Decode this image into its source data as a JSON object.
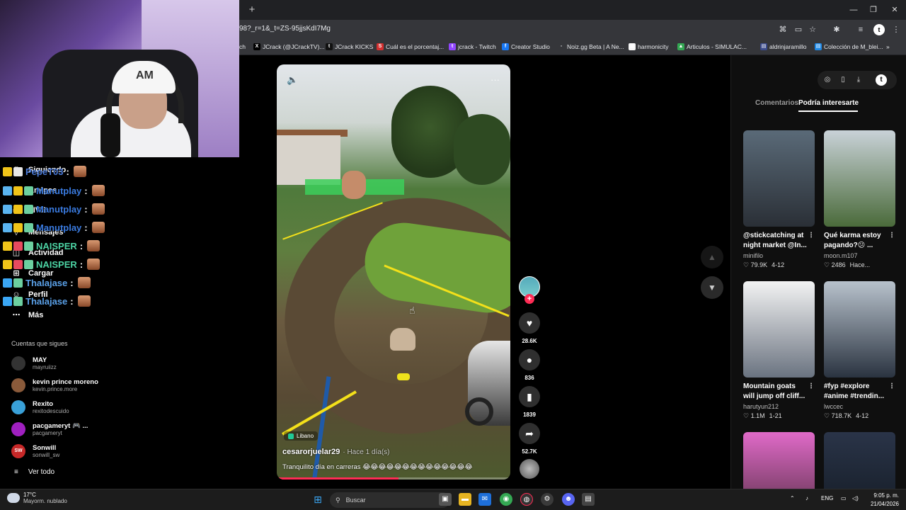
{
  "browser": {
    "url": "98?_r=1&_t=ZS-95jjsKdI7Mg",
    "bookmarks": [
      {
        "label": "ch",
        "icon_color": "#35363a",
        "glyph": ""
      },
      {
        "label": "JCrack (@JCrackTV)...",
        "icon_color": "#000000",
        "glyph": "X"
      },
      {
        "label": "JCrack KICKS",
        "icon_color": "#111111",
        "glyph": "t"
      },
      {
        "label": "Cuál es el porcentaj...",
        "icon_color": "#d32f2f",
        "glyph": "S"
      },
      {
        "label": "jcrack - Twitch",
        "icon_color": "#9146ff",
        "glyph": "t"
      },
      {
        "label": "Creator Studio",
        "icon_color": "#1877f2",
        "glyph": "f"
      },
      {
        "label": "Noiz.gg Beta | A Ne...",
        "icon_color": "#35363a",
        "glyph": "◦"
      },
      {
        "label": "harmonicity",
        "icon_color": "#f5f5f5",
        "glyph": "▦"
      },
      {
        "label": "Articulos - SIMULAC...",
        "icon_color": "#34a853",
        "glyph": "▲"
      },
      {
        "label": "aldrinjaramillo",
        "icon_color": "#3a4a8a",
        "glyph": "▤"
      },
      {
        "label": "Colección de M_blei...",
        "icon_color": "#1e88e5",
        "glyph": "▤"
      }
    ],
    "bookmarks_more": "»",
    "profile_initial": "t"
  },
  "webcam": {
    "cap_logo": "AM"
  },
  "chat": [
    {
      "user": "PepeT03",
      "color": "#4b7bd8"
    },
    {
      "user": "Manutplay",
      "color": "#3a7be0"
    },
    {
      "user": "Manutplay",
      "color": "#3a7be0"
    },
    {
      "user": "Manutplay",
      "color": "#3a7be0"
    },
    {
      "user": "NAISPER",
      "color": "#4cd3a4"
    },
    {
      "user": "NAISPER",
      "color": "#4cd3a4"
    },
    {
      "user": "Thalajase",
      "color": "#5aa0e8"
    },
    {
      "user": "Thalajase",
      "color": "#5aa0e8"
    }
  ],
  "chat_separator": ":",
  "sidebar": {
    "nav": [
      {
        "label": "Siguiendo",
        "icon": "following-icon",
        "glyph": "⚇"
      },
      {
        "label": "Amigos",
        "icon": "friends-icon",
        "glyph": "⚉"
      },
      {
        "label": "LIVE",
        "icon": "live-icon",
        "glyph": "▭"
      },
      {
        "label": "Mensajes",
        "icon": "messages-icon",
        "glyph": "▽"
      },
      {
        "label": "Actividad",
        "icon": "activity-icon",
        "glyph": "◫"
      },
      {
        "label": "Cargar",
        "icon": "upload-icon",
        "glyph": "⊞"
      },
      {
        "label": "Perfil",
        "icon": "profile-icon",
        "glyph": "☺"
      },
      {
        "label": "Más",
        "icon": "more-icon",
        "glyph": "⋯"
      }
    ],
    "following_title": "Cuentas que sigues",
    "accounts": [
      {
        "name": "MAY",
        "handle": "mayruiizz",
        "color": "#333333",
        "initial": ""
      },
      {
        "name": "kevin prince moreno",
        "handle": "kevin.prince.more",
        "color": "#8a5a3a",
        "initial": ""
      },
      {
        "name": "Rexito",
        "handle": "rexitodescuido",
        "color": "#39a0d8",
        "initial": ""
      },
      {
        "name": "pacgameryt 🎮 ...",
        "handle": "pacgameryt",
        "color": "#a020c0",
        "initial": ""
      },
      {
        "name": "Sonwill",
        "handle": "sonwill_sw",
        "color": "#c62828",
        "initial": "SW"
      }
    ],
    "see_all": "Ver todo"
  },
  "video": {
    "location": "Libano",
    "author": "cesarorjuelar29",
    "time": "· Hace 1 día(s)",
    "caption": "Tranquilito día en carreras 😂😂😂😂😂😂😂😂😂😂😂😂😂😂",
    "progress_pct": 52,
    "volume_icon": "🔈",
    "more_icon": "···"
  },
  "actions": {
    "likes": "28.6K",
    "comments": "836",
    "saves": "1839",
    "shares": "52.7K"
  },
  "right_panel": {
    "tabs": [
      "Comentarios",
      "Podría interesarte"
    ],
    "active_tab": "Podría interesarte",
    "cards": [
      {
        "title": "@stickcatching at night market @In...",
        "author": "minifilo",
        "likes": "♡ 79.9K",
        "date": "4-12",
        "bg": "linear-gradient(#5a6a78,#2a2f36)"
      },
      {
        "title": "Qué karma estoy pagando?😕 ...",
        "author": "moon.m107",
        "likes": "♡ 2486",
        "date": "Hace...",
        "bg": "linear-gradient(#c9d2d8,#4a6a3a)"
      },
      {
        "title": "Mountain goats will jump off cliff...",
        "author": "harutyun212",
        "likes": "♡ 1.1M",
        "date": "1-21",
        "bg": "linear-gradient(#f3f3f3,#6a7380)"
      },
      {
        "title": "#fyp #explore #anime #trendin...",
        "author": "lwccec",
        "likes": "♡ 718.7K",
        "date": "4-12",
        "bg": "linear-gradient(#b8c2cc,#2a3340)"
      },
      {
        "title": "",
        "author": "",
        "likes": "",
        "date": "",
        "bg": "linear-gradient(#e06ac8,#4a2a3a)"
      },
      {
        "title": "",
        "author": "",
        "likes": "",
        "date": "",
        "bg": "linear-gradient(#2a3448,#111820)"
      }
    ]
  },
  "taskbar": {
    "temp": "17°C",
    "weather": "Mayorm. nublado",
    "search_placeholder": "Buscar",
    "lang": "ENG",
    "time": "9:05 p. m.",
    "date": "21/04/2026"
  }
}
